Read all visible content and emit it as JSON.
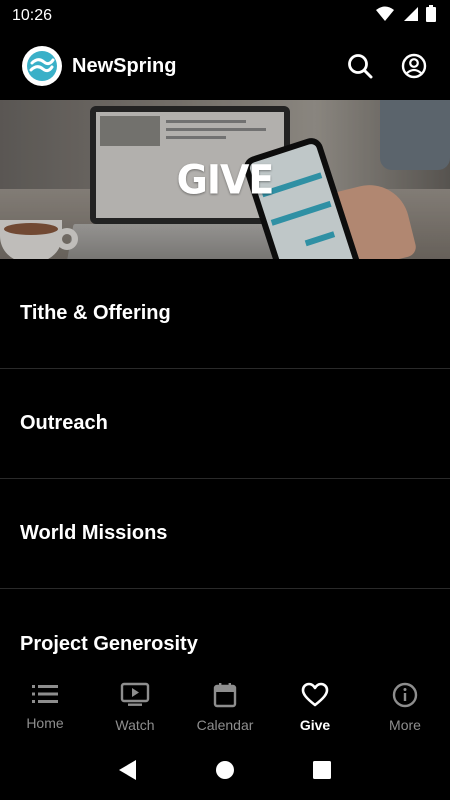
{
  "status_bar": {
    "time": "10:26"
  },
  "header": {
    "app_name": "NewSpring",
    "brand_color": "#3ab0c8"
  },
  "banner": {
    "title": "GIVE"
  },
  "give_items": [
    {
      "label": "Tithe & Offering"
    },
    {
      "label": "Outreach"
    },
    {
      "label": "World Missions"
    },
    {
      "label": "Project Generosity"
    }
  ],
  "tabs": [
    {
      "label": "Home",
      "icon": "list-icon"
    },
    {
      "label": "Watch",
      "icon": "tv-play-icon"
    },
    {
      "label": "Calendar",
      "icon": "calendar-icon"
    },
    {
      "label": "Give",
      "icon": "heart-icon",
      "active": true
    },
    {
      "label": "More",
      "icon": "info-icon"
    }
  ],
  "colors": {
    "background": "#000000",
    "inactive_tab": "#8e8e8e",
    "active_tab": "#ffffff"
  }
}
